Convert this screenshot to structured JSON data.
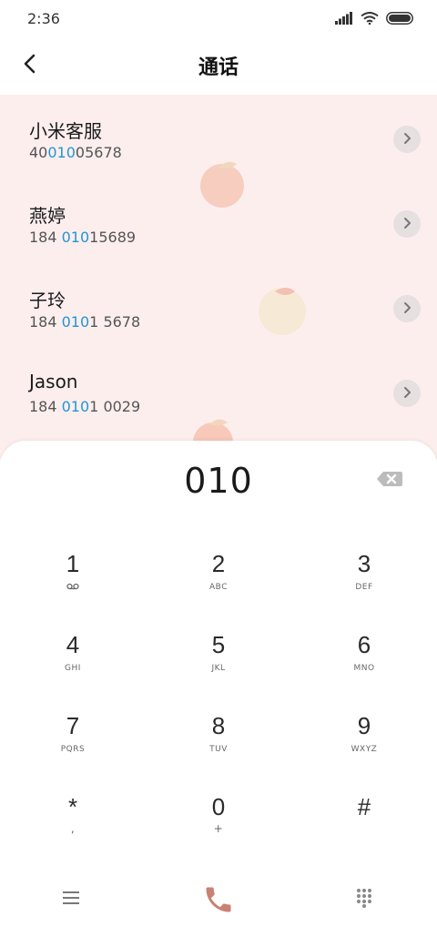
{
  "status_bar": {
    "time": "2:36"
  },
  "header": {
    "title": "通话"
  },
  "results": [
    {
      "name": "小米客服",
      "number_pre": "40",
      "number_hl": "010",
      "number_post": "05678"
    },
    {
      "name": "燕婷",
      "number_pre": "184 ",
      "number_hl": "010",
      "number_post": "15689"
    },
    {
      "name": "子玲",
      "number_pre": "184 ",
      "number_hl": "010",
      "number_post": "1 5678"
    },
    {
      "name": "Jason",
      "number_pre": "184 ",
      "number_hl": "010",
      "number_post": "1 0029"
    }
  ],
  "dialpad": {
    "input": "010",
    "keys": [
      {
        "digit": "1",
        "sub": ""
      },
      {
        "digit": "2",
        "sub": "ABC"
      },
      {
        "digit": "3",
        "sub": "DEF"
      },
      {
        "digit": "4",
        "sub": "GHI"
      },
      {
        "digit": "5",
        "sub": "JKL"
      },
      {
        "digit": "6",
        "sub": "MNO"
      },
      {
        "digit": "7",
        "sub": "PQRS"
      },
      {
        "digit": "8",
        "sub": "TUV"
      },
      {
        "digit": "9",
        "sub": "WXYZ"
      },
      {
        "digit": "*",
        "sub": ","
      },
      {
        "digit": "0",
        "sub": "+"
      },
      {
        "digit": "#",
        "sub": ""
      }
    ]
  },
  "colors": {
    "highlight": "#2196d3",
    "results_bg": "#fdeeee",
    "call": "#c98173"
  },
  "icons": {
    "back": "back-arrow-icon",
    "detail": "chevron-right-icon",
    "backspace": "backspace-icon",
    "voicemail": "voicemail-icon",
    "menu": "menu-icon",
    "call": "phone-icon",
    "keypad": "dialpad-icon"
  }
}
